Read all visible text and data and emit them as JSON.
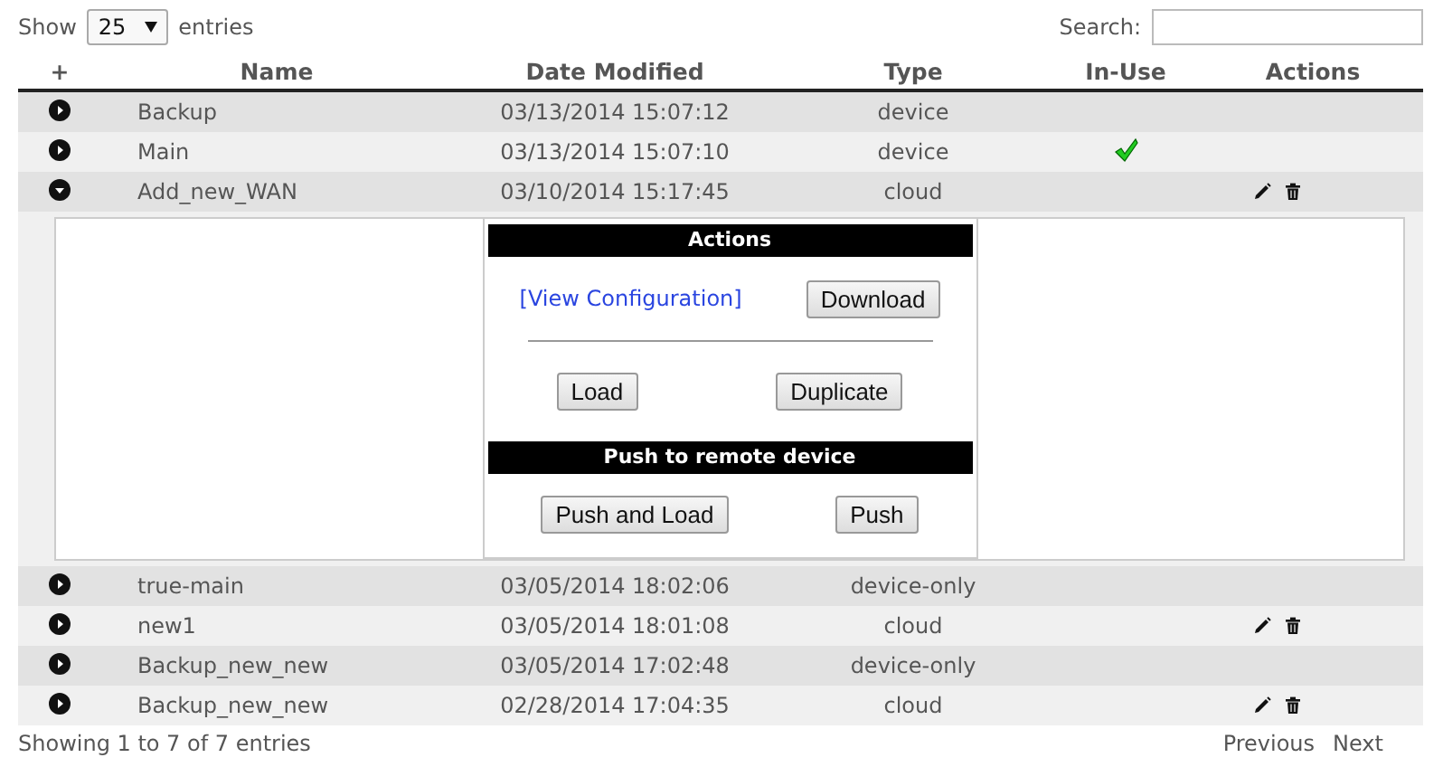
{
  "length_menu": {
    "before": "Show",
    "value": "25",
    "after": "entries"
  },
  "search": {
    "label": "Search:"
  },
  "columns": [
    "+",
    "Name",
    "Date Modified",
    "Type",
    "In-Use",
    "Actions"
  ],
  "rows": [
    {
      "name": "Backup",
      "date": "03/13/2014 15:07:12",
      "type": "device",
      "in_use": false,
      "editable": false,
      "expanded": false
    },
    {
      "name": "Main",
      "date": "03/13/2014 15:07:10",
      "type": "device",
      "in_use": true,
      "editable": false,
      "expanded": false
    },
    {
      "name": "Add_new_WAN",
      "date": "03/10/2014 15:17:45",
      "type": "cloud",
      "in_use": false,
      "editable": true,
      "expanded": true,
      "detail": {
        "actions_title": "Actions",
        "link": "[View Configuration]",
        "download": "Download",
        "load": "Load",
        "duplicate": "Duplicate",
        "push_title": "Push to remote device",
        "push_and_load": "Push and Load",
        "push": "Push"
      }
    },
    {
      "name": "true-main",
      "date": "03/05/2014 18:02:06",
      "type": "device-only",
      "in_use": false,
      "editable": false,
      "expanded": false
    },
    {
      "name": "new1",
      "date": "03/05/2014 18:01:08",
      "type": "cloud",
      "in_use": false,
      "editable": true,
      "expanded": false
    },
    {
      "name": "Backup_new_new",
      "date": "03/05/2014 17:02:48",
      "type": "device-only",
      "in_use": false,
      "editable": false,
      "expanded": false
    },
    {
      "name": "Backup_new_new",
      "date": "02/28/2014 17:04:35",
      "type": "cloud",
      "in_use": false,
      "editable": true,
      "expanded": false
    }
  ],
  "info": "Showing 1 to 7 of 7 entries",
  "pager": [
    "Previous",
    "Next"
  ]
}
